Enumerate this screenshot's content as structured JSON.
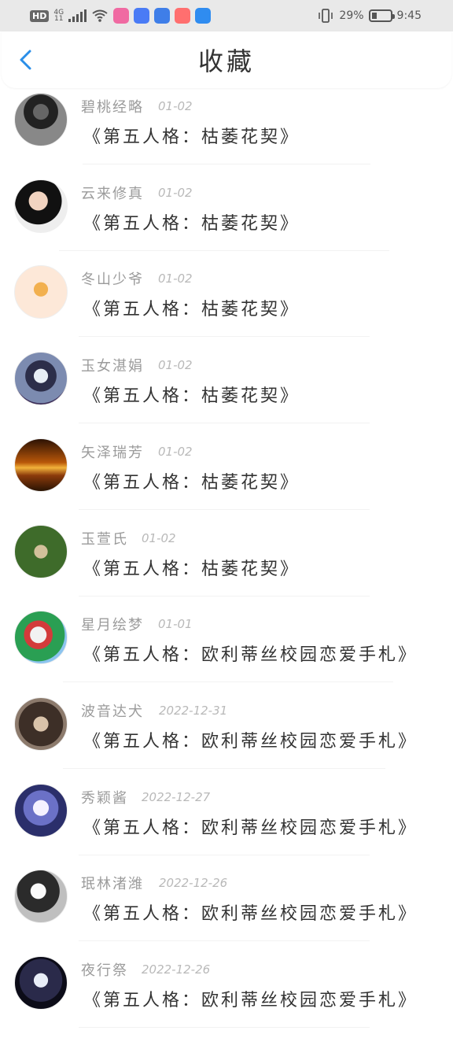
{
  "status_bar": {
    "hd": "HD",
    "net_top": "4G",
    "net_bottom": "11",
    "battery_percent": "29%",
    "time": "9:45",
    "apps": [
      {
        "name": "colorful-app-icon",
        "color": "#f06aa2"
      },
      {
        "name": "music-app-icon",
        "color": "#4a7bf5"
      },
      {
        "name": "edu-app-icon",
        "color": "#3f7ee8"
      },
      {
        "name": "red-app-icon",
        "color": "#ff6f6f"
      },
      {
        "name": "cloud-app-icon",
        "color": "#2f8cf0"
      }
    ]
  },
  "header": {
    "title": "收藏"
  },
  "colors": {
    "accent": "#2a8ee8",
    "text_primary": "#333333",
    "text_secondary": "#9b9b9b",
    "date": "#b9b9b9"
  },
  "favorites": [
    {
      "name": "碧桃经略",
      "date": "01-02",
      "book": "《第五人格：枯萎花契》"
    },
    {
      "name": "云来修真",
      "date": "01-02",
      "book": "《第五人格：枯萎花契》"
    },
    {
      "name": "冬山少爷",
      "date": "01-02",
      "book": "《第五人格：枯萎花契》"
    },
    {
      "name": "玉女湛娟",
      "date": "01-02",
      "book": "《第五人格：枯萎花契》"
    },
    {
      "name": "矢泽瑞芳",
      "date": "01-02",
      "book": "《第五人格：枯萎花契》"
    },
    {
      "name": "玉萱氏",
      "date": "01-02",
      "book": "《第五人格：枯萎花契》"
    },
    {
      "name": "星月绘梦",
      "date": "01-01",
      "book": "《第五人格：欧利蒂丝校园恋爱手札》"
    },
    {
      "name": "波音达犬",
      "date": "2022-12-31",
      "book": "《第五人格：欧利蒂丝校园恋爱手札》"
    },
    {
      "name": "秀颖酱",
      "date": "2022-12-27",
      "book": "《第五人格：欧利蒂丝校园恋爱手札》"
    },
    {
      "name": "珉林渚潍",
      "date": "2022-12-26",
      "book": "《第五人格：欧利蒂丝校园恋爱手札》"
    },
    {
      "name": "夜行祭",
      "date": "2022-12-26",
      "book": "《第五人格：欧利蒂丝校园恋爱手札》"
    }
  ]
}
